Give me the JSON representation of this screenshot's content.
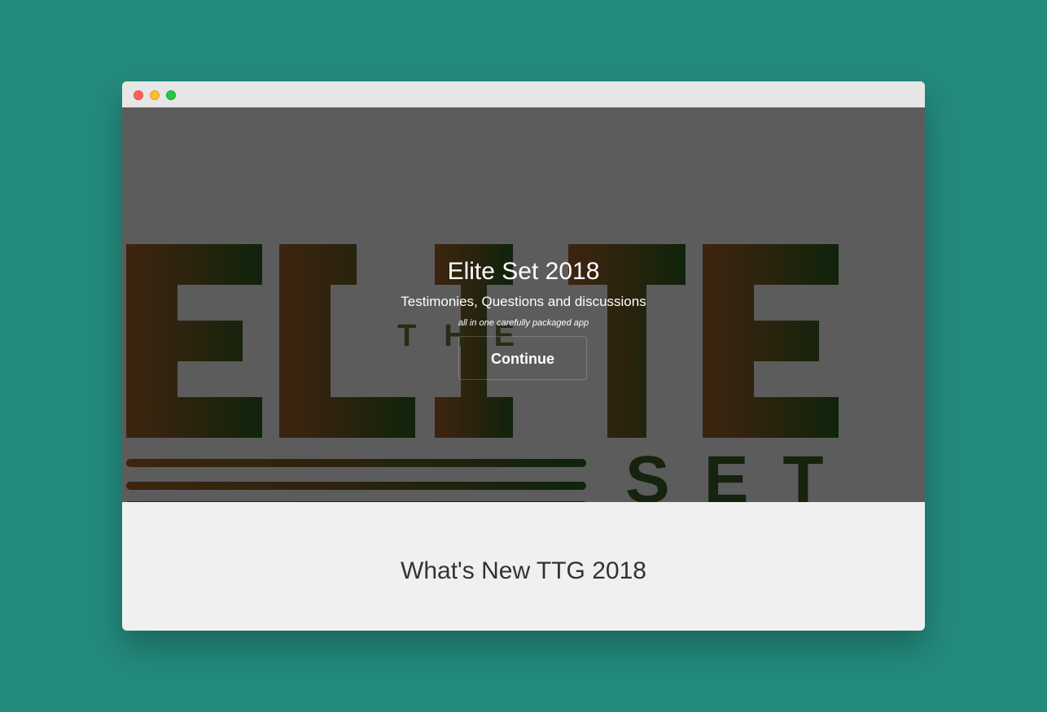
{
  "colors": {
    "desktop_bg": "#238a7c",
    "titlebar_bg": "#e6e6e6",
    "hero_overlay": "#5c5c5c",
    "content_bg": "#f0f0f0",
    "close_dot": "#ff5f57",
    "minimize_dot": "#febc2e",
    "maximize_dot": "#28c840"
  },
  "window": {
    "controls": [
      "close",
      "minimize",
      "maximize"
    ]
  },
  "hero": {
    "background_logo": {
      "main_text": "ELITE",
      "small_text_1": "THE",
      "small_text_2": "SET"
    },
    "title": "Elite Set 2018",
    "subtitle": "Testimonies, Questions and discussions",
    "tagline": "all in one carefully packaged app",
    "continue_label": "Continue"
  },
  "section": {
    "title": "What's New TTG 2018"
  }
}
